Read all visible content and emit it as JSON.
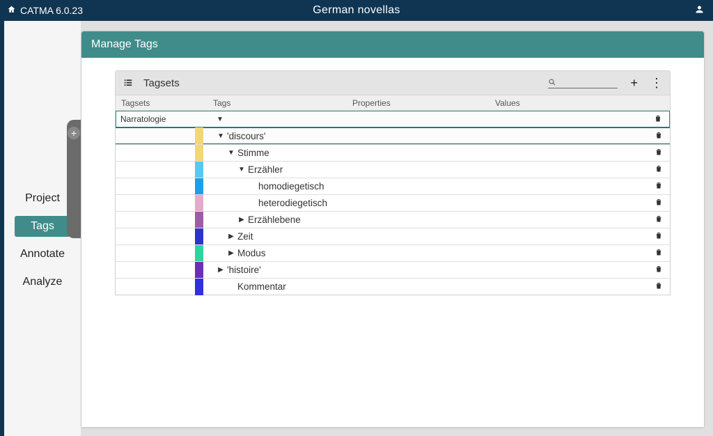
{
  "header": {
    "app_name": "CATMA 6.0.23",
    "project_title": "German novellas"
  },
  "sidebar": {
    "items": [
      {
        "label": "Project",
        "active": false
      },
      {
        "label": "Tags",
        "active": true
      },
      {
        "label": "Annotate",
        "active": false
      },
      {
        "label": "Analyze",
        "active": false
      }
    ]
  },
  "panel": {
    "title": "Manage Tags"
  },
  "toolbar": {
    "section_label": "Tagsets",
    "search_placeholder": ""
  },
  "columns": {
    "tagsets": "Tagsets",
    "tags": "Tags",
    "properties": "Properties",
    "values": "Values"
  },
  "tagset": {
    "name": "Narratologie"
  },
  "tags": [
    {
      "label": "'discours'",
      "indent": 0,
      "expanded": true,
      "swatch": "#f3d676",
      "has_children": true
    },
    {
      "label": "Stimme",
      "indent": 1,
      "expanded": true,
      "swatch": "#f3d676",
      "has_children": true
    },
    {
      "label": "Erzähler",
      "indent": 2,
      "expanded": true,
      "swatch": "#5cc7f2",
      "has_children": true
    },
    {
      "label": "homodiegetisch",
      "indent": 3,
      "expanded": false,
      "swatch": "#1f9ee8",
      "has_children": false
    },
    {
      "label": "heterodiegetisch",
      "indent": 3,
      "expanded": false,
      "swatch": "#e8a9c9",
      "has_children": false
    },
    {
      "label": "Erzählebene",
      "indent": 2,
      "expanded": false,
      "swatch": "#a15aa9",
      "has_children": true
    },
    {
      "label": "Zeit",
      "indent": 1,
      "expanded": false,
      "swatch": "#2a36c9",
      "has_children": true
    },
    {
      "label": "Modus",
      "indent": 1,
      "expanded": false,
      "swatch": "#2ed4a0",
      "has_children": true
    },
    {
      "label": "'histoire'",
      "indent": 0,
      "expanded": false,
      "swatch": "#6b2fb3",
      "has_children": true
    },
    {
      "label": "Kommentar",
      "indent": 1,
      "expanded": false,
      "swatch": "#3030e0",
      "has_children": false
    }
  ]
}
